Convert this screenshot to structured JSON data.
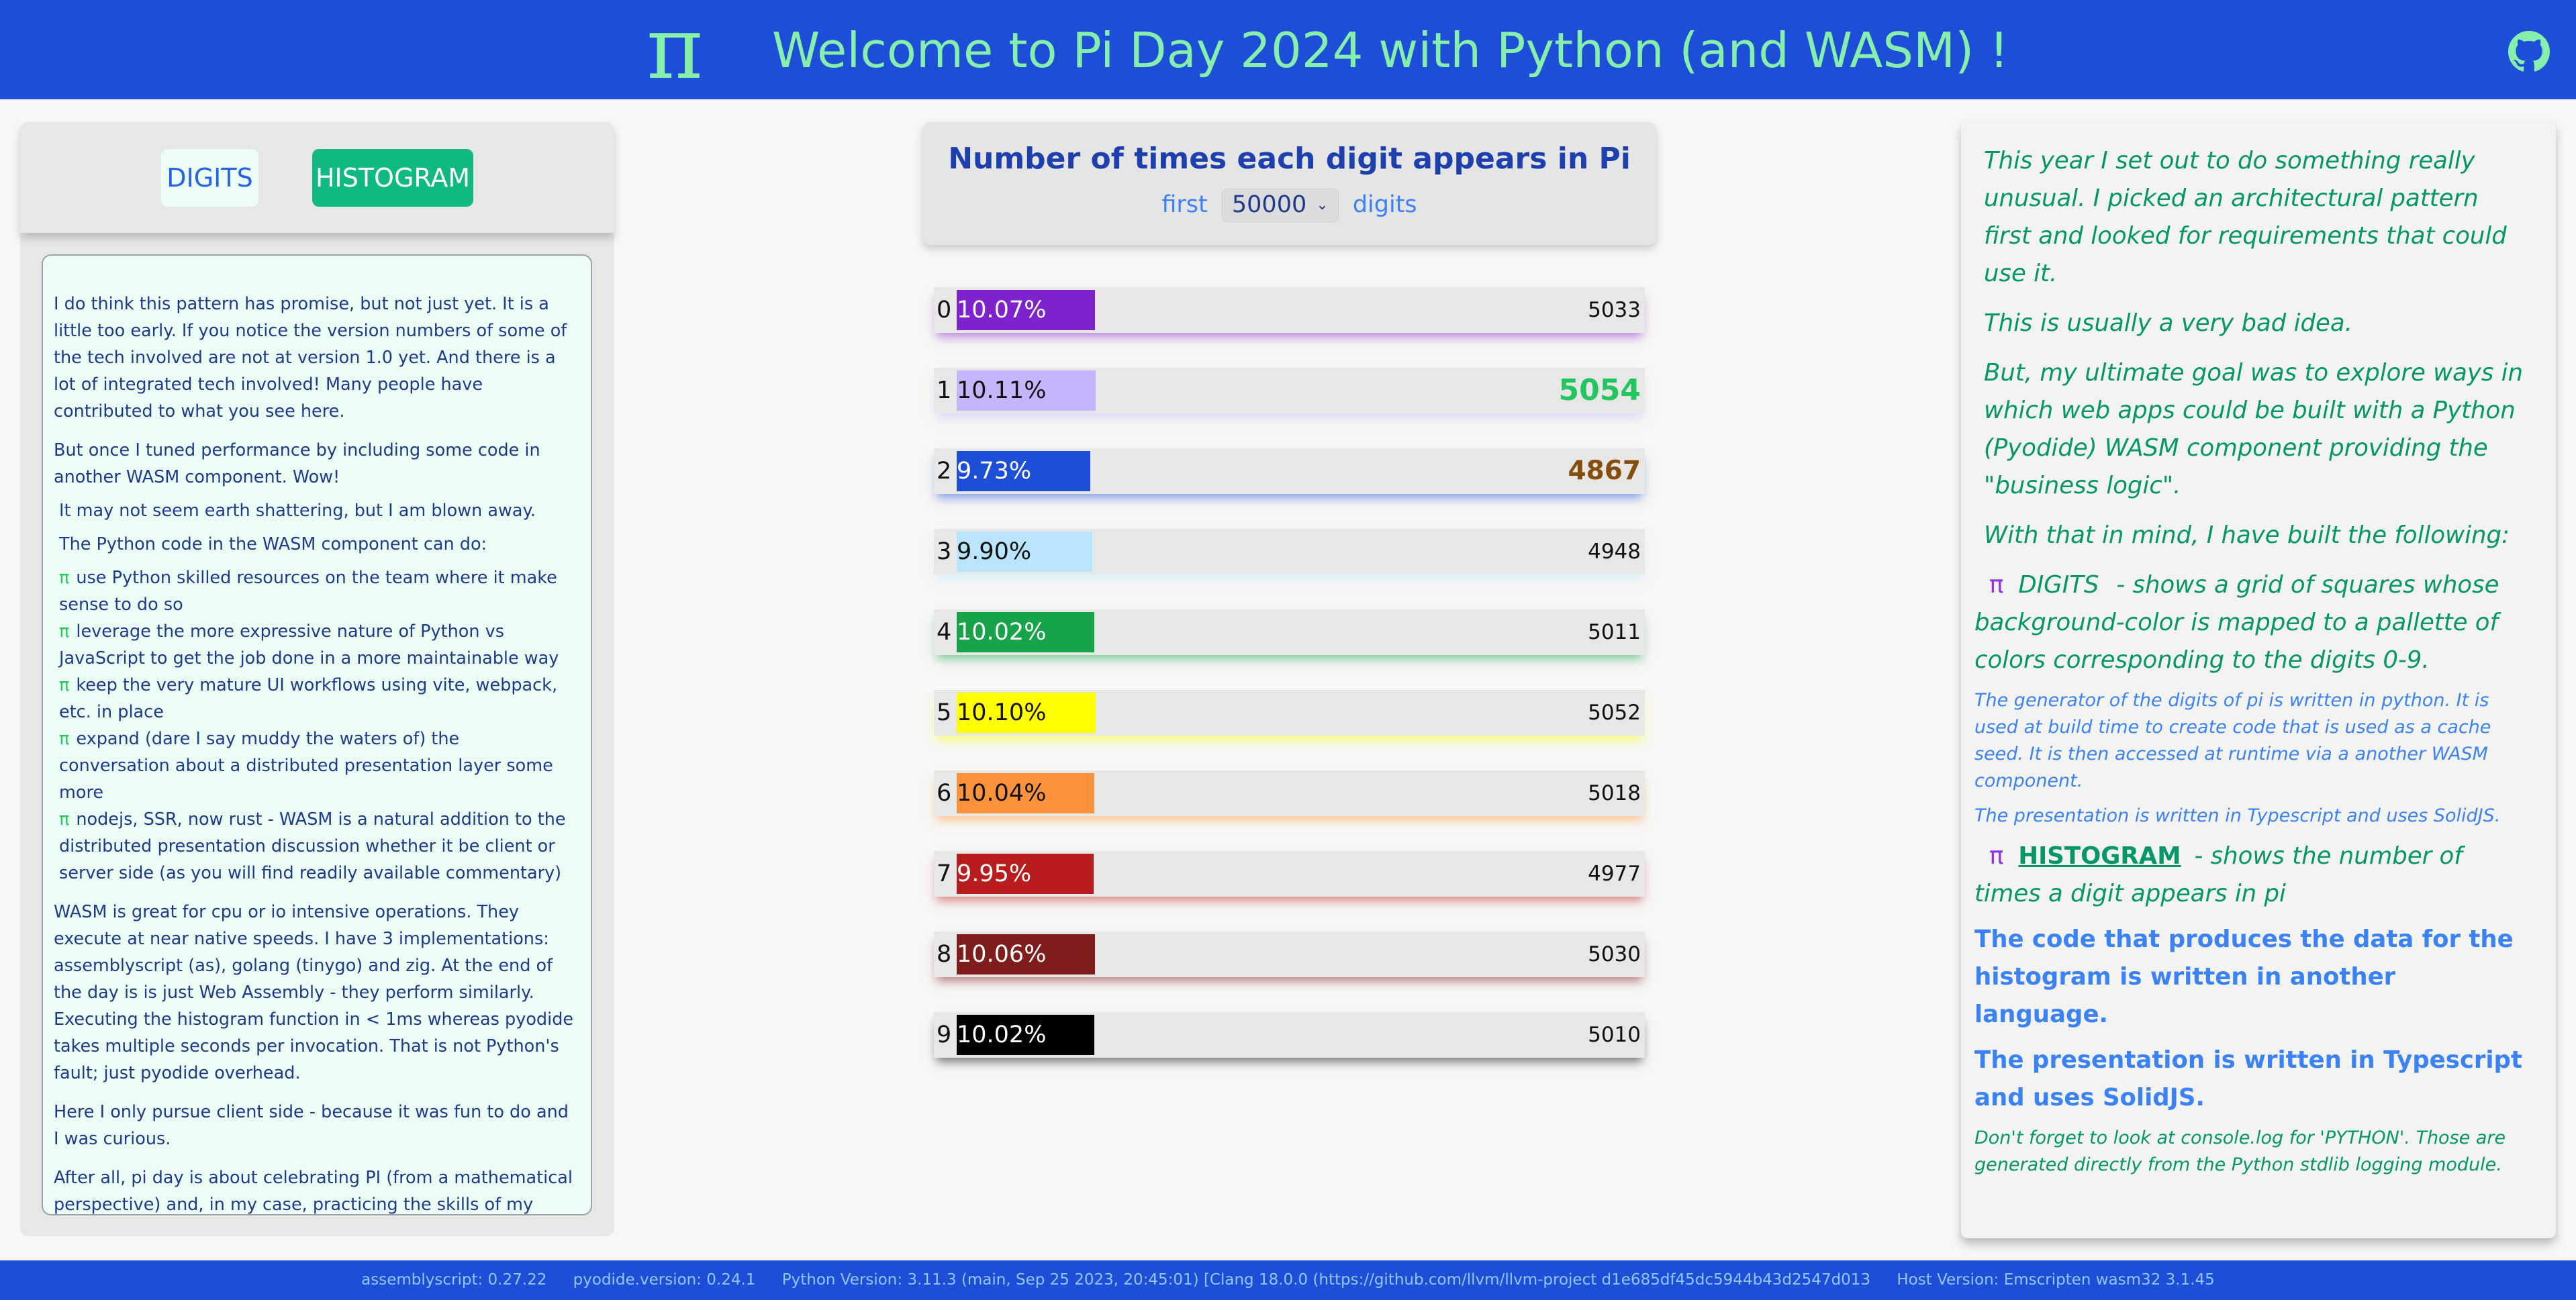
{
  "header": {
    "logo_glyph": "π",
    "title": "Welcome to Pi Day 2024 with Python (and WASM) !",
    "github_icon": "github-icon"
  },
  "tabs": [
    {
      "label": "DIGITS",
      "selected": false
    },
    {
      "label": "HISTOGRAM",
      "selected": true
    }
  ],
  "left_text": {
    "p1": "I do think this pattern has promise, but not just yet. It is a little too early. If you notice the version numbers of some of the tech involved are not at version 1.0 yet. And there is a lot of integrated tech involved! Many people have contributed to what you see here.",
    "p2": "But once I tuned performance by including some code in another WASM component. Wow!",
    "p3": "It may not seem earth shattering, but I am blown away.",
    "p4": "The Python code in the WASM component can do:",
    "bullet_glyph": "π",
    "bullets": [
      "use Python skilled resources on the team where it make sense to do so",
      "leverage the more expressive nature of Python vs JavaScript to get the job done in a more maintainable way",
      "keep the very mature UI workflows using vite, webpack, etc. in place",
      "expand (dare I say muddy the waters of) the conversation about a distributed presentation layer some more",
      "nodejs, SSR, now rust - WASM is a natural addition to the distributed presentation discussion whether it be client or server side (as you will find readily available commentary)"
    ],
    "p5": "WASM is great for cpu or io intensive operations. They execute at near native speeds. I have 3 implementations: assemblyscript (as), golang (tinygo) and zig. At the end of the day is is just Web Assembly - they perform similarly. Executing the histogram function in < 1ms whereas pyodide takes multiple seconds per invocation. That is not Python's fault; just pyodide overhead.",
    "p6": "Here I only pursue client side - because it was fun to do and I was curious.",
    "p7": "After all, pi day is about celebrating PI (from a mathematical perspective) and, in my case, practicing the skills of my craft."
  },
  "chart_header": {
    "title": "Number of times each digit appears in Pi",
    "prefix": "first",
    "selected_digits": "50000",
    "suffix": "digits"
  },
  "chart_data": {
    "type": "bar",
    "title": "Number of times each digit appears in Pi",
    "categories": [
      "0",
      "1",
      "2",
      "3",
      "4",
      "5",
      "6",
      "7",
      "8",
      "9"
    ],
    "values": [
      5033,
      5054,
      4867,
      4948,
      5011,
      5052,
      5018,
      4977,
      5030,
      5010
    ],
    "percent_labels": [
      "10.07%",
      "10.11%",
      "9.73%",
      "9.90%",
      "10.02%",
      "10.10%",
      "10.04%",
      "9.95%",
      "10.06%",
      "10.02%"
    ],
    "colors": [
      "#7e22ce",
      "#c4b5fd",
      "#1d4ed8",
      "#bae6fd",
      "#16a34a",
      "#ffff00",
      "#fb923c",
      "#b91c1c",
      "#7f1d1d",
      "#000000"
    ],
    "label_colors": [
      "#ffffff",
      "#111111",
      "#ffffff",
      "#111111",
      "#ffffff",
      "#111111",
      "#111111",
      "#ffffff",
      "#ffffff",
      "#ffffff"
    ],
    "max_digit": "1",
    "min_digit": "2"
  },
  "right_text": {
    "p1": "This year I set out to do something really unusual. I picked an architectural pattern first and looked for requirements that could use it.",
    "p2": "This is usually a very bad idea.",
    "p3": "But, my ultimate goal was to explore ways in which web apps could be built with a Python (Pyodide) WASM component providing the \"business logic\".",
    "p4": "With that in mind, I have built the following:",
    "pi_glyph": "π",
    "digits_name": "DIGITS",
    "digits_desc": "- shows a grid of squares whose background-color is mapped to a pallette of colors corresponding to the digits 0-9.",
    "digits_note1": "The generator of the digits of pi is written in python. It is used at build time to create code that is used as a cache seed. It is then accessed at runtime via a another WASM component.",
    "digits_note2": "The presentation is written in Typescript and uses SolidJS.",
    "hist_name": "HISTOGRAM",
    "hist_desc": "- shows the number of times a digit appears in pi",
    "hist_bold1": "The code that produces the data for the histogram is written in another language.",
    "hist_bold2": "The presentation is written in Typescript and uses SolidJS.",
    "console_note": "Don't forget to look at console.log for 'PYTHON'. Those are generated directly from the Python stdlib logging module."
  },
  "footer": {
    "assemblyscript": "assemblyscript: 0.27.22",
    "pyodide": "pyodide.version: 0.24.1",
    "python": "Python Version: 3.11.3 (main, Sep 25 2023, 20:45:01) [Clang 18.0.0 (https://github.com/llvm/llvm-project d1e685df45dc5944b43d2547d013",
    "host": "Host Version: Emscripten wasm32 3.1.45"
  }
}
